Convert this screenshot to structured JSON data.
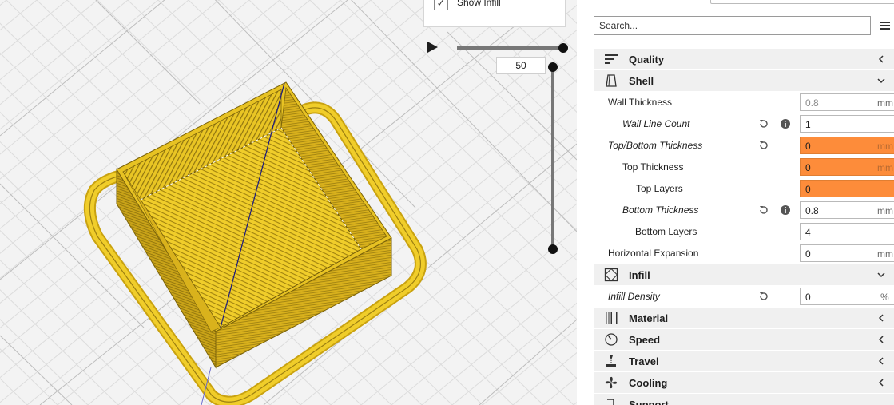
{
  "viewport": {
    "show_infill_label": "Show Infill",
    "show_infill_checked": true,
    "layer_value": "50"
  },
  "panel": {
    "search_placeholder": "Search...",
    "categories": {
      "quality": {
        "label": "Quality",
        "icon": "quality-icon",
        "expanded": false
      },
      "shell": {
        "label": "Shell",
        "icon": "shell-icon",
        "expanded": true
      },
      "infill": {
        "label": "Infill",
        "icon": "infill-icon",
        "expanded": true
      },
      "material": {
        "label": "Material",
        "icon": "material-icon",
        "expanded": false
      },
      "speed": {
        "label": "Speed",
        "icon": "speed-icon",
        "expanded": false
      },
      "travel": {
        "label": "Travel",
        "icon": "travel-icon",
        "expanded": false
      },
      "cooling": {
        "label": "Cooling",
        "icon": "cooling-icon",
        "expanded": false
      },
      "support": {
        "label": "Support",
        "icon": "support-icon",
        "expanded": false
      }
    },
    "settings": {
      "wall_thickness": {
        "label": "Wall Thickness",
        "value": "0.8",
        "unit": "mm"
      },
      "wall_line_count": {
        "label": "Wall Line Count",
        "value": "1",
        "unit": ""
      },
      "top_bottom_thickness": {
        "label": "Top/Bottom Thickness",
        "value": "0",
        "unit": "mm"
      },
      "top_thickness": {
        "label": "Top Thickness",
        "value": "0",
        "unit": "mm"
      },
      "top_layers": {
        "label": "Top Layers",
        "value": "0",
        "unit": ""
      },
      "bottom_thickness": {
        "label": "Bottom Thickness",
        "value": "0.8",
        "unit": "mm"
      },
      "bottom_layers": {
        "label": "Bottom Layers",
        "value": "4",
        "unit": ""
      },
      "horizontal_expansion": {
        "label": "Horizontal Expansion",
        "value": "0",
        "unit": "mm"
      },
      "infill_density": {
        "label": "Infill Density",
        "value": "0",
        "unit": "%"
      }
    },
    "colors": {
      "warning": "#fd8c3a",
      "model": "#e8c21e",
      "category_bg": "#f0f0f0"
    }
  }
}
